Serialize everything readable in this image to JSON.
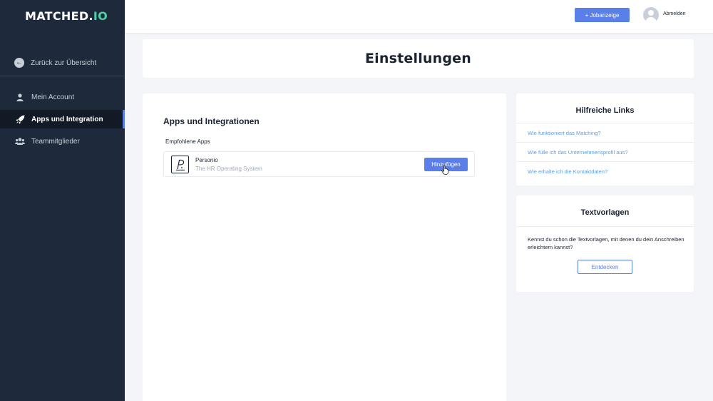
{
  "brand": {
    "logo_main": "MATCHED.",
    "logo_accent": "IO",
    "accent_color": "#4fd1a5"
  },
  "sidebar": {
    "back_label": "Zurück zur Übersicht",
    "items": [
      {
        "label": "Mein Account",
        "icon": "user-icon"
      },
      {
        "label": "Apps und Integration",
        "icon": "rocket-icon",
        "active": true
      },
      {
        "label": "Teammitglieder",
        "icon": "users-icon"
      }
    ]
  },
  "topbar": {
    "job_button": "+ Jobanzeige",
    "logout_label": "Abmelden"
  },
  "page": {
    "title": "Einstellungen"
  },
  "main": {
    "section_title": "Apps und Integrationen",
    "recommended_label": "Empfohlene Apps",
    "apps": [
      {
        "name": "Personio",
        "description": "The HR Operating System",
        "button": "Hinzufügen"
      }
    ]
  },
  "helpful_links": {
    "title": "Hilfreiche Links",
    "links": [
      "Wie funktioniert das Matching?",
      "Wie fülle ich das Unternehmensprofil aus?",
      "Wie erhalte ich die Kontaktdaten?"
    ]
  },
  "templates": {
    "title": "Textvorlagen",
    "text": "Kennst du schon die Textvorlagen, mit denen du dein Anschreiben erleichtern kannst?",
    "button": "Entdecken"
  },
  "colors": {
    "primary": "#5b7fe8",
    "sidebar": "#1e2a3b",
    "link": "#5b9ee8"
  }
}
